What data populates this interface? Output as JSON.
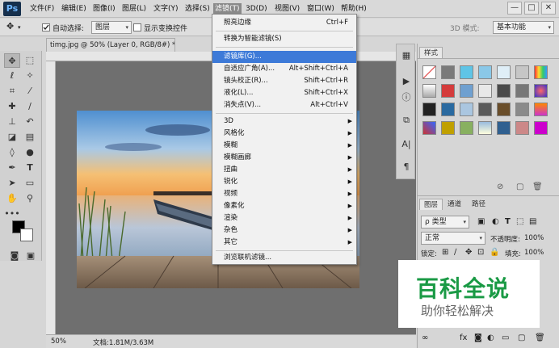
{
  "app": {
    "logo": "Ps"
  },
  "menubar": {
    "items": [
      "文件(F)",
      "编辑(E)",
      "图像(I)",
      "图层(L)",
      "文字(Y)",
      "选择(S)",
      "滤镜(T)",
      "3D(D)",
      "视图(V)",
      "窗口(W)",
      "帮助(H)"
    ],
    "active_index": 6,
    "window_buttons": [
      "—",
      "□",
      "✕"
    ]
  },
  "options_bar": {
    "auto_select_label": "自动选择:",
    "auto_select_value": "图层",
    "show_transform_label": "显示变换控件",
    "mode_3d_label": "3D 模式:",
    "workspace_value": "基本功能"
  },
  "document": {
    "tab_title": "timg.jpg @ 50% (Layer 0, RGB/8#) *",
    "zoom": "50%",
    "doc_size": "文档:1.81M/3.63M"
  },
  "filter_menu": {
    "items": [
      {
        "label": "照亮边缘",
        "shortcut": "Ctrl+F"
      },
      {
        "label": "转换为智能滤镜(S)",
        "shortcut": ""
      },
      {
        "label": "滤镜库(G)...",
        "shortcut": "",
        "highlight": true
      },
      {
        "label": "自适应广角(A)...",
        "shortcut": "Alt+Shift+Ctrl+A"
      },
      {
        "label": "镜头校正(R)...",
        "shortcut": "Shift+Ctrl+R"
      },
      {
        "label": "液化(L)...",
        "shortcut": "Shift+Ctrl+X"
      },
      {
        "label": "消失点(V)...",
        "shortcut": "Alt+Ctrl+V"
      },
      {
        "label": "3D",
        "submenu": true
      },
      {
        "label": "风格化",
        "submenu": true
      },
      {
        "label": "模糊",
        "submenu": true
      },
      {
        "label": "模糊画廊",
        "submenu": true
      },
      {
        "label": "扭曲",
        "submenu": true
      },
      {
        "label": "锐化",
        "submenu": true
      },
      {
        "label": "视频",
        "submenu": true
      },
      {
        "label": "像素化",
        "submenu": true
      },
      {
        "label": "渲染",
        "submenu": true
      },
      {
        "label": "杂色",
        "submenu": true
      },
      {
        "label": "其它",
        "submenu": true
      },
      {
        "label": "浏览联机滤镜...",
        "shortcut": ""
      }
    ]
  },
  "styles_panel": {
    "tab": "样式"
  },
  "layers_panel": {
    "tabs": [
      "图层",
      "通道",
      "路径"
    ],
    "filter_kind": "ρ 类型",
    "blend_mode": "正常",
    "opacity_label": "不透明度:",
    "opacity_value": "100%",
    "lock_label": "锁定:",
    "fill_label": "填充:",
    "fill_value": "100%"
  },
  "watermark": {
    "title": "百科全说",
    "subtitle": "助你轻松解决"
  },
  "colors": {
    "highlight": "#3d7ad8",
    "watermark_green": "#1a9a45"
  }
}
